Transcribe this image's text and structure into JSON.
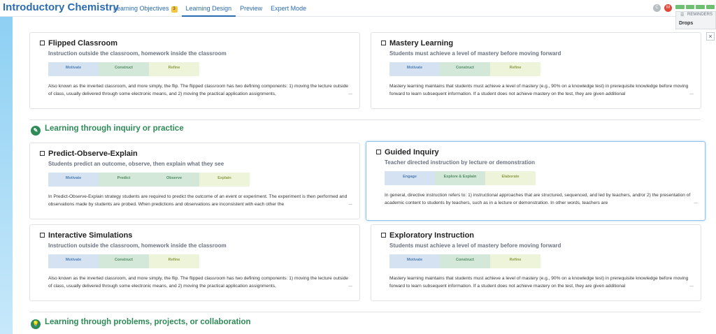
{
  "app": {
    "title": "Introductory Chemistry"
  },
  "tabs": [
    {
      "label": "Learning Objectives",
      "badge": "3",
      "active": false
    },
    {
      "label": "Learning Design",
      "active": true
    },
    {
      "label": "Preview",
      "active": false
    },
    {
      "label": "Expert Mode",
      "active": false
    }
  ],
  "top_right": {
    "gray_avatar": "C",
    "red_avatar": "M"
  },
  "reminders": {
    "label": "REMINDERS",
    "item": "Drops",
    "icon": "list-icon"
  },
  "close_button": {
    "label": "×"
  },
  "ellipsis": "...",
  "sections": [
    {
      "title": "Learning through inquiry or practice",
      "icon": "pencil-icon"
    },
    {
      "title": "Learning through problems, projects, or collaboration",
      "icon": "lightbulb-icon"
    }
  ],
  "cards": [
    {
      "title": "Flipped Classroom",
      "subtitle": "Instruction outside the classroom, homework inside the classroom",
      "phases": [
        "Motivate",
        "Construct",
        "Refine"
      ],
      "body": "Also known as the inverted classroom, and more simply, the flip. The flipped classroom has two defining components: 1) moving the lecture outside of class, usually delivered through some electronic means, and 2) moving the practical application assignments,"
    },
    {
      "title": "Mastery Learning",
      "subtitle": "Students must achieve a level of mastery before moving forward",
      "phases": [
        "Motivate",
        "Construct",
        "Refine"
      ],
      "body": "Mastery learning maintains that students must achieve a level of mastery (e.g., 90% on a knowledge test) in prerequisite knowledge before moving forward to learn subsequent information. If a student does not achieve mastery on the test, they are given additional"
    },
    {
      "title": "Predict-Observe-Explain",
      "subtitle": "Students predict an outcome, observe, then explain what they see",
      "phases": [
        "Motivate",
        "Predict",
        "Observe",
        "Explain"
      ],
      "body": "In Predict-Observe-Explain strategy students are required to predict the outcome of an event or experiment. The experiment is then performed and observations made by students are probed. When predictions and observations are inconsistent with each other the"
    },
    {
      "title": "Guided Inquiry",
      "subtitle": "Teacher directed instruction by lecture or demonstration",
      "phases": [
        "Engage",
        "Explore & Explain",
        "Elaborate"
      ],
      "body": "In general, directive instruction refers to: 1) instructional approaches that are structured, sequenced, and led by teachers, and/or 2) the presentation of academic content to students by teachers, such as in a lecture or demonstration. In other words, teachers are"
    },
    {
      "title": "Interactive Simulations",
      "subtitle": "Instruction outside the classroom, homework inside the classroom",
      "phases": [
        "Motivate",
        "Construct",
        "Refine"
      ],
      "body": "Also known as the inverted classroom, and more simply, the flip. The flipped classroom has two defining components: 1) moving the lecture outside of class, usually delivered through some electronic means, and 2) moving the practical application assignments,"
    },
    {
      "title": "Exploratory Instruction",
      "subtitle": "Students must achieve a level of mastery before moving forward",
      "phases": [
        "Motivate",
        "Construct",
        "Refine"
      ],
      "body": "Mastery learning maintains that students must achieve a level of mastery (e.g., 90% on a knowledge test) in prerequisite knowledge before moving forward to learn subsequent information. If a student does not achieve mastery on the test, they are given additional"
    }
  ]
}
